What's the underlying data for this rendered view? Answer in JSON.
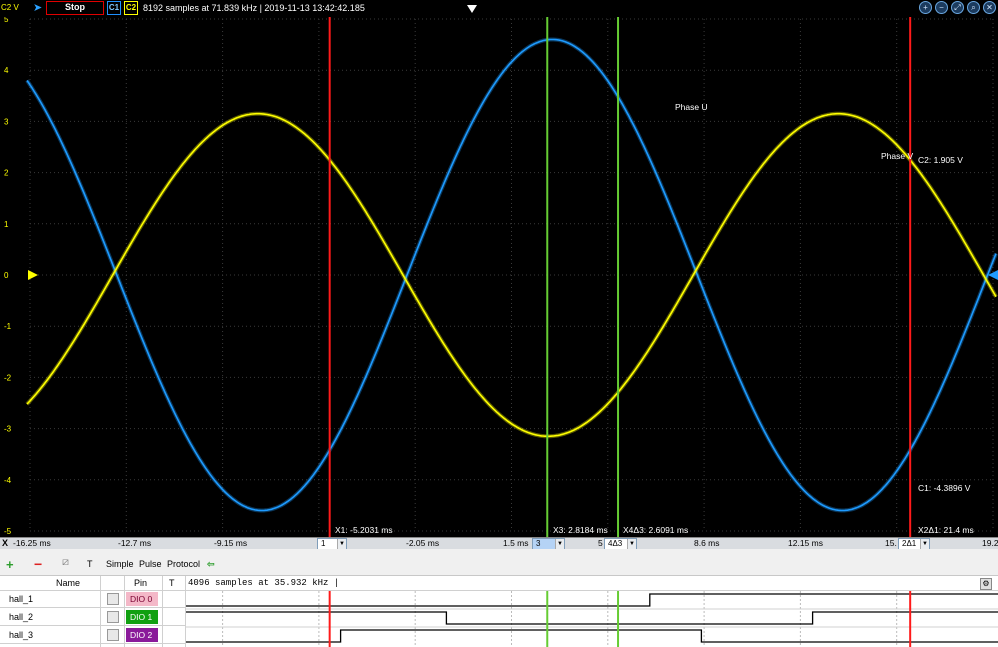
{
  "toolbar": {
    "channel_label": "C2 V",
    "stop_label": "Stop",
    "c1_label": "C1",
    "c2_label": "C2",
    "status": "8192 samples at 71.839 kHz | 2019-11-13 13:42:42.185",
    "zoom_icons": [
      "zoom-in-icon",
      "zoom-out-icon",
      "zoom-fit-icon",
      "zoom-icon",
      "close-icon"
    ],
    "zoom_glyphs": [
      "+",
      "−",
      "⤢",
      "⌕",
      "✕"
    ]
  },
  "plot": {
    "background": "#000000",
    "grid_color": "#3a3a3a",
    "y_ticks": [
      "5",
      "4",
      "3",
      "2",
      "1",
      "0",
      "-1",
      "-2",
      "-3",
      "-4",
      "-5"
    ],
    "trace_labels": {
      "phase_u": "Phase U",
      "phase_v": "Phase V"
    },
    "cursor_readouts": {
      "x1": "X1: -5.2031 ms",
      "x3": "X3: 2.8184 ms",
      "x4": "X4Δ3: 2.6091 ms",
      "x2": "X2Δ1: 21.4 ms",
      "c2_value": "C2: 1.905 V",
      "c1_value": "C1: -4.3896 V"
    }
  },
  "chart_data": {
    "type": "line",
    "xlabel": "",
    "ylabel": "C2 V",
    "x_unit": "ms",
    "xlim": [
      -16.25,
      19.25
    ],
    "ylim": [
      -5,
      5
    ],
    "x_ticks": [
      "-16.25 ms",
      "-12.7 ms",
      "-9.15 ms",
      "-2.05 ms",
      "1.5 ms",
      "8.6 ms",
      "12.15 ms",
      "19.2"
    ],
    "series": [
      {
        "name": "Phase U",
        "channel": "C1",
        "color": "#1e9bff",
        "amplitude": 4.6,
        "period_ms": 21.4,
        "peak_ms": 3.0,
        "min_ms": -6.1
      },
      {
        "name": "Phase V",
        "channel": "C2",
        "color": "#ffff00",
        "amplitude": 3.15,
        "period_ms": 21.4,
        "peak_ms": 13.55,
        "min_ms": 3.4
      }
    ],
    "cursors": [
      {
        "id": "X1",
        "x_ms": -5.2031,
        "color": "#ff1a1a"
      },
      {
        "id": "X2",
        "x_ms": 16.1969,
        "color": "#ff1a1a"
      },
      {
        "id": "X3",
        "x_ms": 2.8184,
        "color": "#66cc33"
      },
      {
        "id": "X4",
        "x_ms": 5.4275,
        "color": "#66cc33"
      }
    ]
  },
  "xaxis": {
    "menu_label": "X",
    "tick_labels": [
      "-16.25 ms",
      "-12.7 ms",
      "-9.15 ms",
      "-2.05 ms",
      "1.5 ms",
      "5",
      "8.6 ms",
      "12.15 ms",
      "15.",
      "19.2"
    ],
    "cursor_boxes": {
      "c1": "1",
      "c3": "3",
      "c4": "4Δ3",
      "c2": "2Δ1"
    }
  },
  "logic_toolbar": {
    "add_label": "+",
    "remove_label": "−",
    "edit_label": "⧄",
    "t_label": "T",
    "simple_label": "Simple",
    "pulse_label": "Pulse",
    "protocol_label": "Protocol",
    "arrow_label": "⇦"
  },
  "logic": {
    "headers": {
      "name": "Name",
      "pin": "Pin",
      "t": "T",
      "samples": "4096 samples at 35.932 kHz |"
    },
    "rows": [
      {
        "name": "hall_1",
        "pin": "DIO 0",
        "pin_bg": "#f4b8c8",
        "pin_fg": "#7a0030"
      },
      {
        "name": "hall_2",
        "pin": "DIO 1",
        "pin_bg": "#11a011",
        "pin_fg": "#ffffff"
      },
      {
        "name": "hall_3",
        "pin": "DIO 2",
        "pin_bg": "#8a1a9a",
        "pin_fg": "#ffffff"
      }
    ],
    "transitions_ms": [
      {
        "initial": 1,
        "edges": [
          -12.4,
          6.6
        ]
      },
      {
        "initial": 1,
        "edges": [
          -0.9,
          12.6
        ]
      },
      {
        "initial": 0,
        "edges": [
          -4.8,
          8.5
        ]
      }
    ]
  }
}
